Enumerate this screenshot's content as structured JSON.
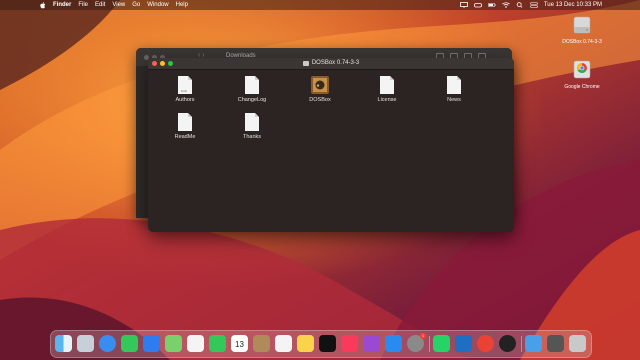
{
  "menubar": {
    "app": "Finder",
    "items": [
      "File",
      "Edit",
      "View",
      "Go",
      "Window",
      "Help"
    ],
    "clock": "Tue 13 Dec  10:33 PM"
  },
  "desktop": {
    "icons": [
      {
        "label": "DOSBox 0.74-3-3",
        "icon": "disk-image-icon"
      },
      {
        "label": "Google Chrome",
        "icon": "chrome-disk-icon"
      }
    ]
  },
  "back_window": {
    "title": "Downloads"
  },
  "finder": {
    "title": "DOSBox 0.74-3-3",
    "files": [
      {
        "name": "Authors",
        "icon": "document-icon"
      },
      {
        "name": "ChangeLog",
        "icon": "document-icon"
      },
      {
        "name": "DOSBox",
        "icon": "dosbox-app-icon"
      },
      {
        "name": "License",
        "icon": "document-icon"
      },
      {
        "name": "News",
        "icon": "document-icon"
      },
      {
        "name": "ReadMe",
        "icon": "document-icon"
      },
      {
        "name": "Thanks",
        "icon": "document-icon"
      }
    ]
  },
  "dock": {
    "calendar_day": "13",
    "system_settings_badge": "1",
    "apps": [
      "finder-icon",
      "launchpad-icon",
      "safari-icon",
      "messages-icon",
      "mail-icon",
      "maps-icon",
      "photos-icon",
      "facetime-icon",
      "calendar-icon",
      "contacts-icon",
      "reminders-icon",
      "notes-icon",
      "apple-tv-icon",
      "music-icon",
      "podcasts-icon",
      "app-store-icon",
      "system-settings-icon",
      "whatsapp-icon",
      "vscode-icon",
      "chrome-icon",
      "clock-icon",
      "downloads-icon",
      "screenshot-icon",
      "trash-icon"
    ]
  }
}
